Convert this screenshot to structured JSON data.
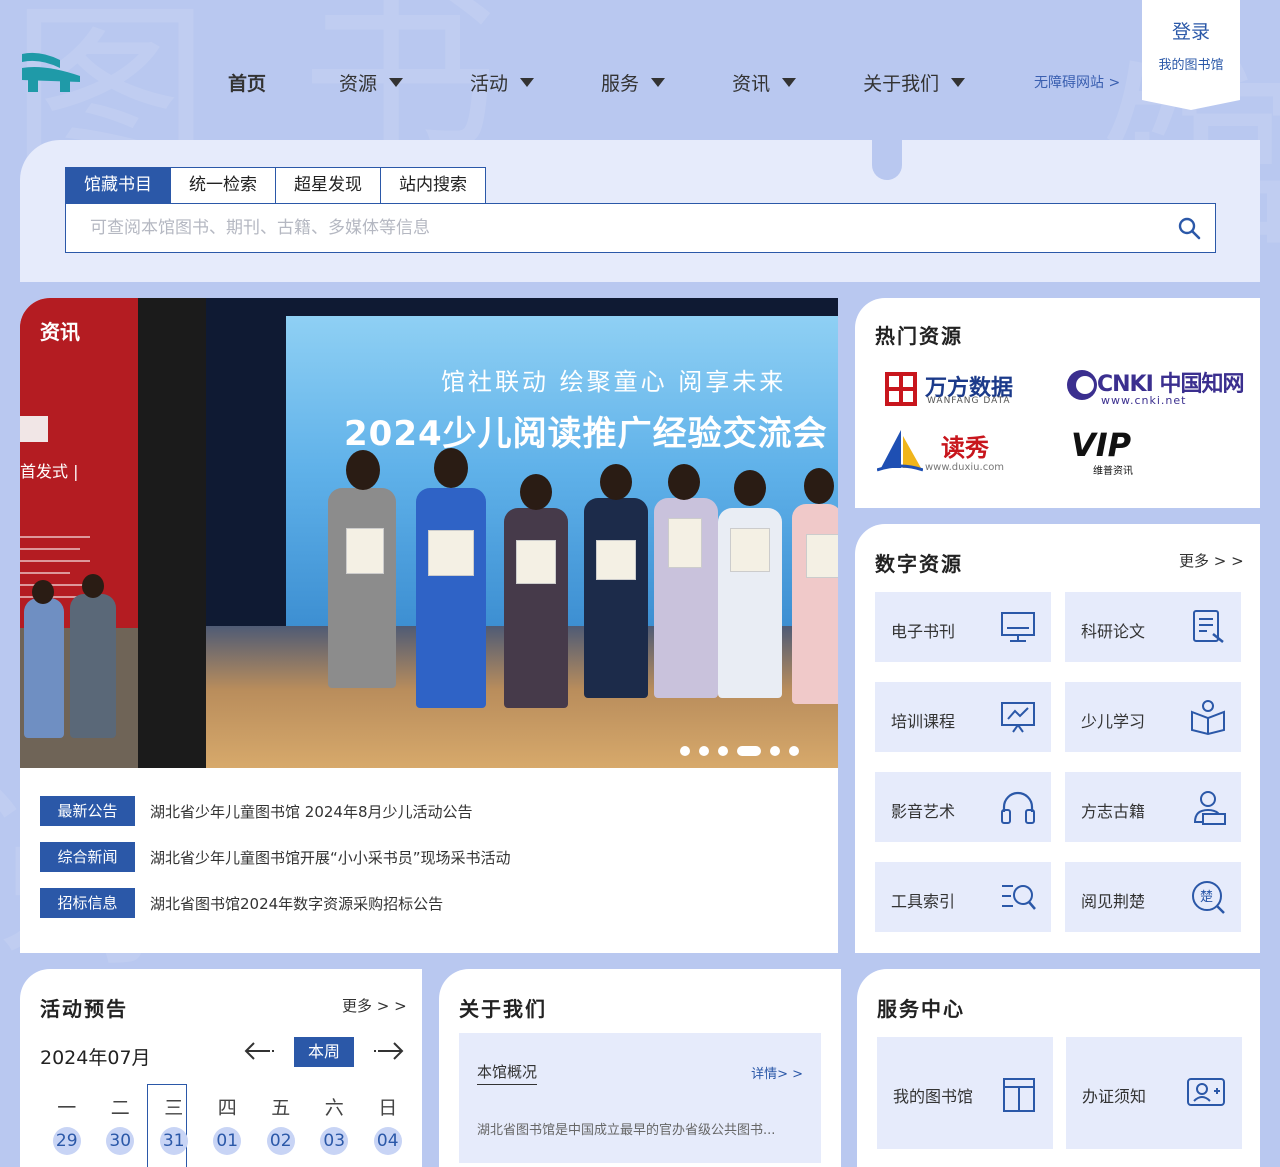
{
  "header": {
    "nav": [
      {
        "label": "首页",
        "dropdown": false
      },
      {
        "label": "资源",
        "dropdown": true
      },
      {
        "label": "活动",
        "dropdown": true
      },
      {
        "label": "服务",
        "dropdown": true
      },
      {
        "label": "资讯",
        "dropdown": true
      },
      {
        "label": "关于我们",
        "dropdown": true
      }
    ],
    "accessibility_link": "无障碍网站 >",
    "login": "登录",
    "my_library": "我的图书馆"
  },
  "search": {
    "tabs": [
      "馆藏书目",
      "统一检索",
      "超星发现",
      "站内搜索"
    ],
    "active_tab": 0,
    "placeholder": "可查阅本馆图书、期刊、古籍、多媒体等信息"
  },
  "news": {
    "badge": "资讯",
    "slide_headline_1": "馆社联动 绘聚童心 阅享未来",
    "slide_headline_2": "2024少儿阅读推广经验交流会",
    "slide_side_text": "首发式 |",
    "slide_count": 6,
    "active_slide": 3,
    "items": [
      {
        "tag": "最新公告",
        "title": "湖北省少年儿童图书馆 2024年8月少儿活动公告"
      },
      {
        "tag": "综合新闻",
        "title": "湖北省少年儿童图书馆开展“小小采书员”现场采书活动"
      },
      {
        "tag": "招标信息",
        "title": "湖北省图书馆2024年数字资源采购招标公告"
      }
    ]
  },
  "hot_resources": {
    "title": "热门资源",
    "items": [
      {
        "name": "万方数据",
        "sub": "WANFANG DATA"
      },
      {
        "name": "CNKI 中国知网",
        "sub": "www.cnki.net"
      },
      {
        "name": "读秀",
        "sub": "www.duxiu.com"
      },
      {
        "name": "VIP",
        "sub": "维普资讯"
      }
    ]
  },
  "digital_resources": {
    "title": "数字资源",
    "more": "更多 > >",
    "items": [
      {
        "label": "电子书刊",
        "icon": "monitor-icon"
      },
      {
        "label": "科研论文",
        "icon": "document-pen-icon"
      },
      {
        "label": "培训课程",
        "icon": "presentation-icon"
      },
      {
        "label": "少儿学习",
        "icon": "child-book-icon"
      },
      {
        "label": "影音艺术",
        "icon": "headphones-icon"
      },
      {
        "label": "方志古籍",
        "icon": "reader-icon"
      },
      {
        "label": "工具索引",
        "icon": "list-search-icon"
      },
      {
        "label": "阅见荆楚",
        "icon": "chu-search-icon"
      }
    ]
  },
  "activities": {
    "title": "活动预告",
    "more": "更多 > >",
    "month": "2024年07月",
    "this_week": "本周",
    "weekdays": [
      "一",
      "二",
      "三",
      "四",
      "五",
      "六",
      "日"
    ],
    "days": [
      "29",
      "30",
      "31",
      "01",
      "02",
      "03",
      "04"
    ],
    "today_index": 2
  },
  "about": {
    "title": "关于我们",
    "subtitle": "本馆概况",
    "detail": "详情> >",
    "description": "湖北省图书馆是中国成立最早的官办省级公共图书..."
  },
  "service": {
    "title": "服务中心",
    "items": [
      {
        "label": "我的图书馆",
        "icon": "bookshelf-icon"
      },
      {
        "label": "办证须知",
        "icon": "id-card-icon"
      }
    ]
  },
  "colors": {
    "background": "#b9c8f0",
    "primary": "#2b58a8",
    "panel": "#e6ebfb",
    "badge_red": "#b41c22"
  }
}
